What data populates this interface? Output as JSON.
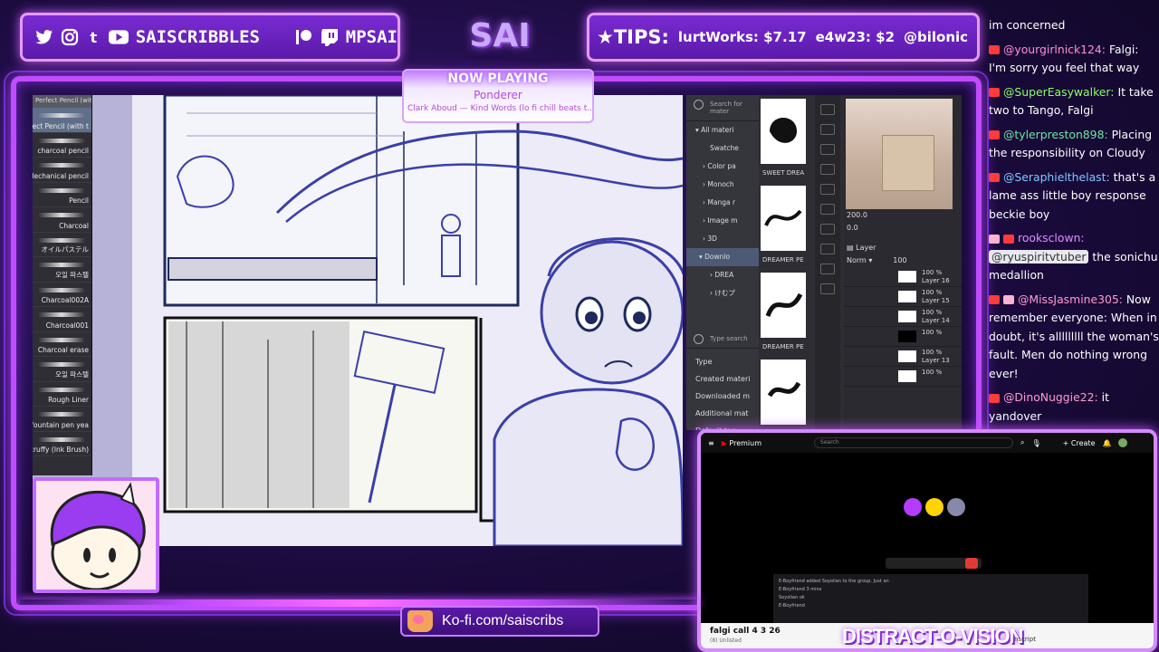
{
  "overlay": {
    "socials_handle": "SAISCRIBBLES",
    "patreon_twitch_handle": "MPSAI",
    "title": "SAI",
    "tips_label": "TIPS:",
    "tips": [
      "lurtWorks: $7.17",
      "e4w23: $2",
      "@bilonic"
    ],
    "kofi": "Ko-fi.com/saiscribs",
    "distract_label": "DISTRACT-O-VISION"
  },
  "now_playing": {
    "heading": "NOW PLAYING",
    "track": "Ponderer",
    "artist": "Clark Aboud — Kind Words (lo fi chill beats t..."
  },
  "brushes": {
    "header": "Perfect Pencil (with t",
    "items": [
      "ect Pencil (with t",
      "charcoal pencil",
      "Mechanical pencil",
      "Pencil",
      "Charcoal",
      "オイルパステル",
      "오일 파스텔",
      "Charcoal002A",
      "Charcoal001",
      "Charcoal erase",
      "오일 파스텔",
      "Rough Liner",
      "fountain pen yea",
      "Scruffy (Ink Brush)"
    ]
  },
  "materials": {
    "search_placeholder": "Search for mater",
    "tree": [
      "All materi",
      "Swatche",
      "Color pa",
      "Monoch",
      "Manga r",
      "Image m",
      "3D",
      "Downlo",
      "DREA",
      "けむプ"
    ],
    "search2": "Type search",
    "bottom": [
      "Type",
      "Created materi",
      "Downloaded m",
      "Additional mat",
      "Default tag"
    ],
    "thumbs": [
      "SWEET DREA",
      "DREAMER PE",
      "DREAMER PE",
      ""
    ]
  },
  "navigator": {
    "zoom": "200.0",
    "rotate": "0.0",
    "layer_label": "Layer",
    "blend": "Norm",
    "opacity": "100",
    "layers": [
      {
        "pct": "100 %",
        "name": "Layer 16"
      },
      {
        "pct": "100 %",
        "name": "Layer 15"
      },
      {
        "pct": "100 %",
        "name": "Layer 14"
      },
      {
        "pct": "100 %",
        "name": ""
      },
      {
        "pct": "100 %",
        "name": "Layer 13"
      },
      {
        "pct": "100 %",
        "name": ""
      }
    ]
  },
  "chat": [
    {
      "user": "",
      "text": "im concerned",
      "color": "#ffffff"
    },
    {
      "user": "@yourgirlnick124:",
      "text": "Falgi: I'm sorry you feel that way",
      "color": "#ff8fd6"
    },
    {
      "user": "@SuperEasywalker:",
      "text": "It take two to Tango, Falgi",
      "color": "#8cff66"
    },
    {
      "user": "@tylerpreston898:",
      "text": "Placing the responsibility on Cloudy",
      "color": "#6be7a2"
    },
    {
      "user": "@Seraphielthelast:",
      "text": "that's a lame ass little boy response beckie boy",
      "color": "#7ec8ff"
    },
    {
      "user": "rooksclown:",
      "mention": "@ryuspiritvtuber",
      "text": "the sonichu medallion",
      "color": "#e38cff"
    },
    {
      "user": "@MissJasmine305:",
      "text": "Now remember everyone: When in doubt, it's alllllllll the woman's fault. Men do nothing wrong ever!",
      "color": "#ff9bd2"
    },
    {
      "user": "@DinoNuggie22:",
      "text": "it yandover",
      "color": "#ff9bd2"
    }
  ],
  "youtube": {
    "premium": "Premium",
    "search": "Search",
    "create": "Create",
    "video_title": "falgi call 4 3 26",
    "sub": "(8) Unlisted",
    "script_tag": "nscript",
    "dc_lines": [
      "E-Boyfriend added Soyolian to the group. Just an",
      "E-Boyfriend  3 mins",
      "Soyolian  ok",
      "E-Boyfriend"
    ]
  }
}
